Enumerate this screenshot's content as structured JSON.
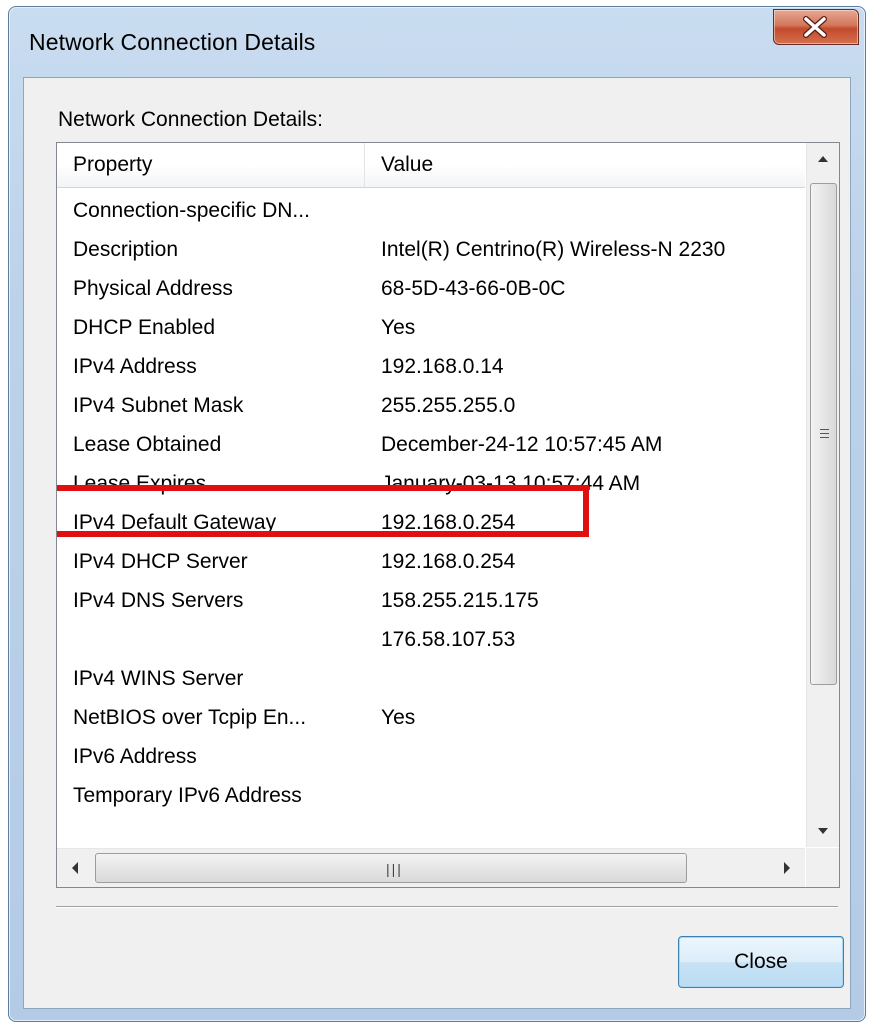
{
  "window": {
    "title": "Network Connection Details"
  },
  "group_label": "Network Connection Details:",
  "table": {
    "columns": [
      "Property",
      "Value"
    ],
    "rows": [
      {
        "property": "Connection-specific DN...",
        "value": ""
      },
      {
        "property": "Description",
        "value": "Intel(R) Centrino(R) Wireless-N 2230"
      },
      {
        "property": "Physical Address",
        "value": "68-5D-43-66-0B-0C"
      },
      {
        "property": "DHCP Enabled",
        "value": "Yes"
      },
      {
        "property": "IPv4 Address",
        "value": "192.168.0.14"
      },
      {
        "property": "IPv4 Subnet Mask",
        "value": "255.255.255.0"
      },
      {
        "property": "Lease Obtained",
        "value": "December-24-12 10:57:45 AM"
      },
      {
        "property": "Lease Expires",
        "value": "January-03-13 10:57:44 AM"
      },
      {
        "property": "IPv4 Default Gateway",
        "value": "192.168.0.254"
      },
      {
        "property": "IPv4 DHCP Server",
        "value": "192.168.0.254"
      },
      {
        "property": "IPv4 DNS Servers",
        "value": "158.255.215.175"
      },
      {
        "property": "",
        "value": "176.58.107.53"
      },
      {
        "property": "IPv4 WINS Server",
        "value": ""
      },
      {
        "property": "NetBIOS over Tcpip En...",
        "value": "Yes"
      },
      {
        "property": "IPv6 Address",
        "value": ""
      },
      {
        "property": "Temporary IPv6 Address",
        "value": ""
      }
    ]
  },
  "buttons": {
    "close_label": "Close"
  },
  "icons": {
    "title_close": "close-icon",
    "scroll_up": "arrow-up-icon",
    "scroll_down": "arrow-down-icon",
    "scroll_left": "arrow-left-icon",
    "scroll_right": "arrow-right-icon"
  },
  "colors": {
    "highlight_border": "#e01010",
    "window_frame": "#bcd2ea",
    "close_button_red": "#c24a2c"
  }
}
